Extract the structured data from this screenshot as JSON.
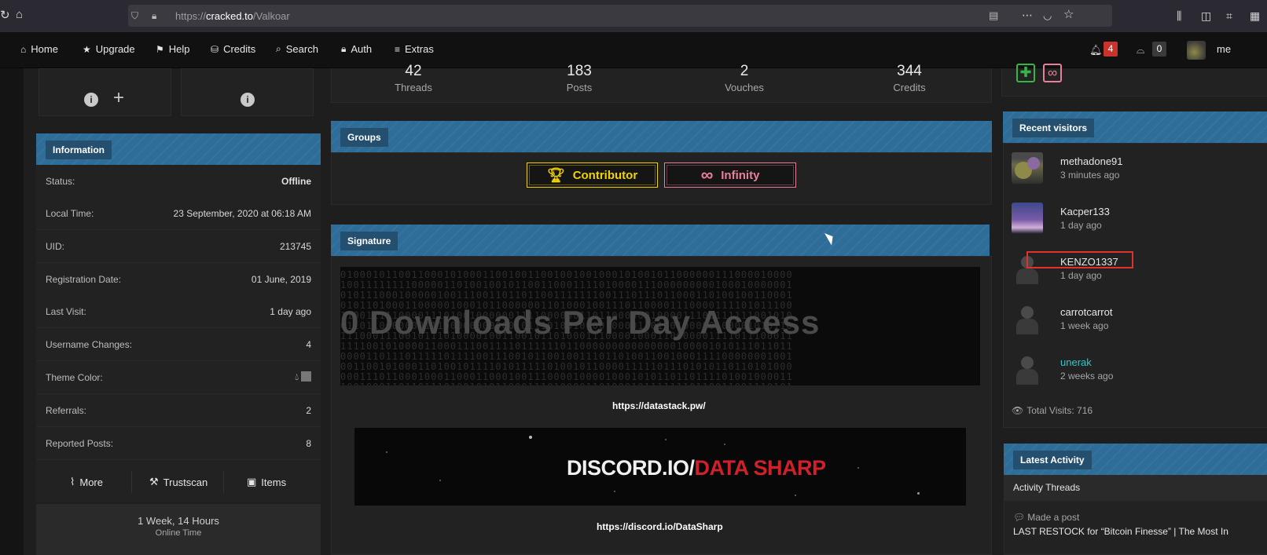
{
  "browser": {
    "url_prefix": "https://",
    "url_host": "cracked.to",
    "url_path": "/Valkoar"
  },
  "nav": {
    "items": [
      {
        "label": "Home",
        "icon": "home-icon"
      },
      {
        "label": "Upgrade",
        "icon": "star-icon"
      },
      {
        "label": "Help",
        "icon": "flag-icon"
      },
      {
        "label": "Credits",
        "icon": "coins-icon"
      },
      {
        "label": "Search",
        "icon": "search-icon"
      },
      {
        "label": "Auth",
        "icon": "lock-icon"
      },
      {
        "label": "Extras",
        "icon": "menu-icon"
      }
    ],
    "notifications_count": "4",
    "messages_count": "0",
    "user_label": "me"
  },
  "stats": [
    {
      "value": "42",
      "label": "Threads"
    },
    {
      "value": "183",
      "label": "Posts"
    },
    {
      "value": "2",
      "label": "Vouches"
    },
    {
      "value": "344",
      "label": "Credits"
    }
  ],
  "information": {
    "title": "Information",
    "rows": [
      {
        "label": "Status:",
        "value": "Offline"
      },
      {
        "label": "Local Time:",
        "value": "23 September, 2020 at 06:18 AM"
      },
      {
        "label": "UID:",
        "value": "213745"
      },
      {
        "label": "Registration Date:",
        "value": "01 June, 2019"
      },
      {
        "label": "Last Visit:",
        "value": "1 day ago"
      },
      {
        "label": "Username Changes:",
        "value": "4"
      },
      {
        "label": "Theme Color:",
        "value": ""
      },
      {
        "label": "Referrals:",
        "value": "2"
      },
      {
        "label": "Reported Posts:",
        "value": "8"
      }
    ],
    "buttons": [
      {
        "label": "More",
        "icon": "activity-icon"
      },
      {
        "label": "Trustscan",
        "icon": "gavel-icon"
      },
      {
        "label": "Items",
        "icon": "box-icon"
      }
    ],
    "online_time": "1 Week, 14 Hours",
    "online_caption": "Online Time"
  },
  "groups": {
    "title": "Groups",
    "badges": [
      "Contributor",
      "Infinity"
    ]
  },
  "signature": {
    "title": "Signature",
    "banner1_text": "0 Downloads Per Day Access",
    "link1": "https://datastack.pw/",
    "banner2_white": "DISCORD.IO/",
    "banner2_red": "DATA SHARP",
    "link2": "https://discord.io/DataSharp"
  },
  "recent_visitors": {
    "title": "Recent visitors",
    "items": [
      {
        "name": "methadone91",
        "time": "3 minutes ago"
      },
      {
        "name": "Kacper133",
        "time": "1 day ago"
      },
      {
        "name": "KENZO1337",
        "time": "1 day ago"
      },
      {
        "name": "carrotcarrot",
        "time": "1 week ago"
      },
      {
        "name": "unerak",
        "time": "2 weeks ago"
      }
    ],
    "total_visits": "Total Visits: 716"
  },
  "latest_activity": {
    "title": "Latest Activity",
    "tab": "Activity Threads",
    "action": "Made a post",
    "thread": "LAST RESTOCK for “Bitcoin Finesse” | The Most In"
  },
  "colors": {
    "accent": "#2f6d99",
    "contributor": "#f2d300",
    "infinity": "#e9809a",
    "highlight_box": "#e0322b",
    "special_user": "#39c3c8"
  }
}
